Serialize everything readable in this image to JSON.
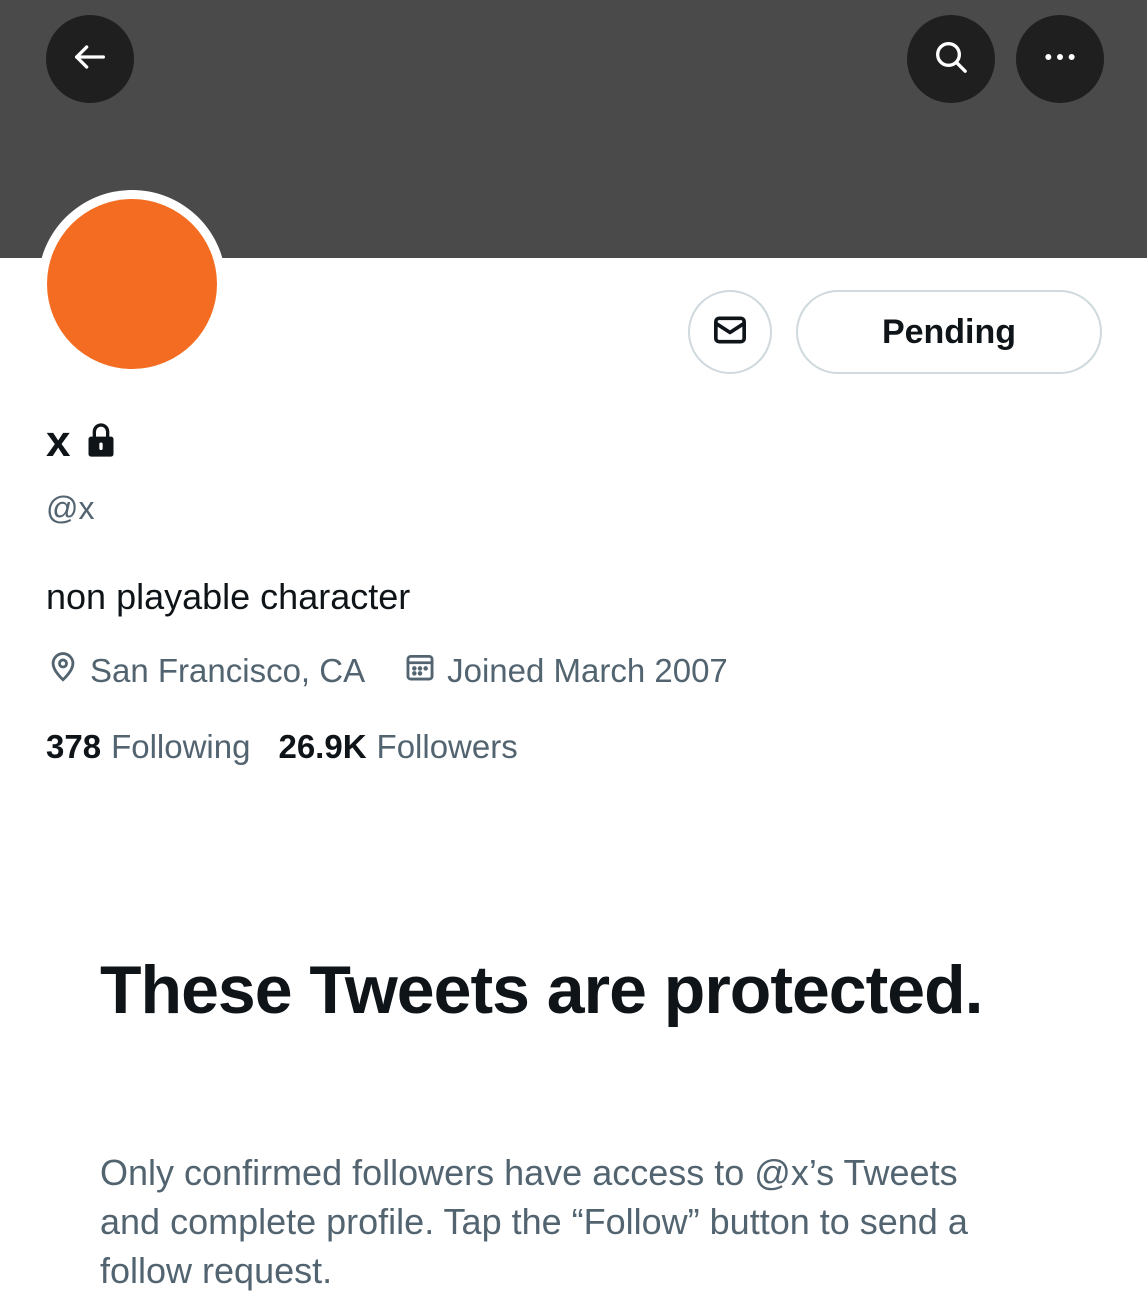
{
  "header": {
    "back_icon": "arrow-left-icon",
    "search_icon": "search-icon",
    "more_icon": "more-horizontal-icon"
  },
  "colors": {
    "banner": "#4a4a4a",
    "avatar": "#f46c22",
    "text_primary": "#0f1419",
    "text_secondary": "#536471"
  },
  "profile": {
    "display_name": "x",
    "protected_icon": "lock-icon",
    "handle": "@x",
    "bio": "non playable character",
    "location": "San Francisco, CA",
    "location_icon": "location-pin-icon",
    "joined": "Joined March 2007",
    "joined_icon": "calendar-icon",
    "following_count": "378",
    "following_label": "Following",
    "followers_count": "26.9K",
    "followers_label": "Followers"
  },
  "actions": {
    "message_icon": "message-icon",
    "pending_label": "Pending"
  },
  "protected_notice": {
    "title": "These Tweets are protected.",
    "description": "Only confirmed followers have access to @x’s Tweets and complete profile. Tap the “Follow” button to send a follow request."
  }
}
